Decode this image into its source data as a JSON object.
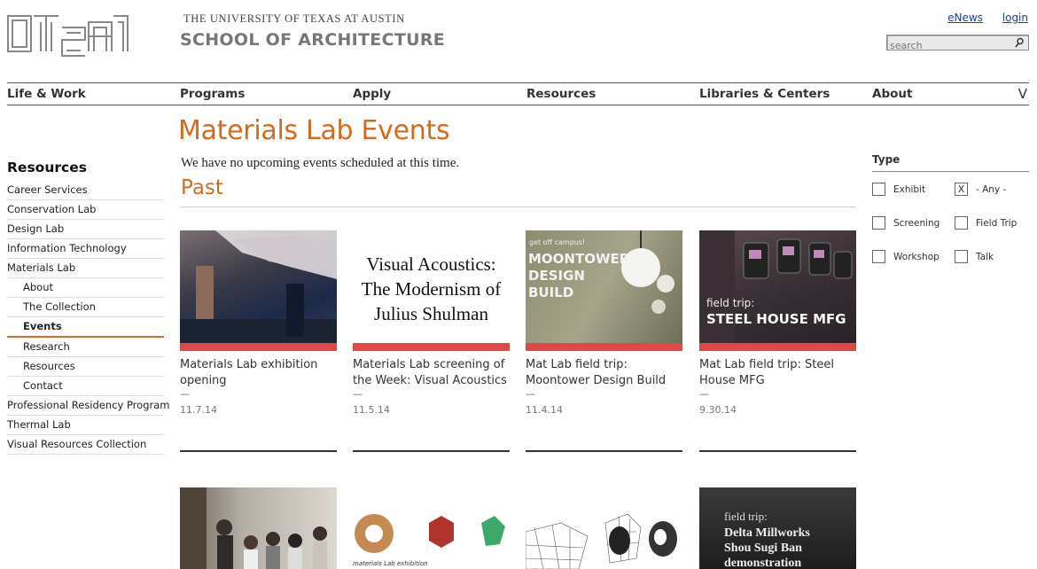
{
  "header": {
    "university": "THE UNIVERSITY OF TEXAS AT AUSTIN",
    "school": "SCHOOL OF ARCHITECTURE",
    "links": [
      "eNews",
      "login"
    ],
    "search_placeholder": "search"
  },
  "nav": {
    "items": [
      "Life & Work",
      "Programs",
      "Apply",
      "Resources",
      "Libraries & Centers",
      "About"
    ],
    "toggle": "V"
  },
  "page": {
    "title": "Materials Lab Events",
    "no_events": "We have no upcoming events scheduled at this time.",
    "past_heading": "Past"
  },
  "sidebar": {
    "heading": "Resources",
    "items": [
      {
        "label": "Career Services",
        "level": 0
      },
      {
        "label": "Conservation Lab",
        "level": 0
      },
      {
        "label": "Design Lab",
        "level": 0
      },
      {
        "label": "Information Technology",
        "level": 0
      },
      {
        "label": "Materials Lab",
        "level": 0
      },
      {
        "label": "About",
        "level": 1
      },
      {
        "label": "The Collection",
        "level": 1
      },
      {
        "label": "Events",
        "level": 1,
        "active": true
      },
      {
        "label": "Research",
        "level": 1
      },
      {
        "label": "Resources",
        "level": 1
      },
      {
        "label": "Contact",
        "level": 1
      },
      {
        "label": "Professional Residency Program",
        "level": 0
      },
      {
        "label": "Thermal Lab",
        "level": 0
      },
      {
        "label": "Visual Resources Collection",
        "level": 0
      }
    ]
  },
  "filters": {
    "heading": "Type",
    "options": [
      {
        "label": "Exhibit",
        "checked": false
      },
      {
        "label": "- Any -",
        "checked": true
      },
      {
        "label": "Screening",
        "checked": false
      },
      {
        "label": "Field Trip",
        "checked": false
      },
      {
        "label": "Workshop",
        "checked": false
      },
      {
        "label": "Talk",
        "checked": false
      }
    ],
    "check_mark": "X"
  },
  "events": [
    {
      "title": "Materials Lab exhibition opening",
      "dash": "—",
      "date": "11.7.14"
    },
    {
      "title": "Materials Lab screening of the Week: Visual Acoustics",
      "dash": "—",
      "date": "11.5.14",
      "thumb_lines": [
        "Visual Acoustics:",
        "The Modernism of",
        "Julius Shulman"
      ]
    },
    {
      "title": "Mat Lab field trip: Moontower Design Build",
      "dash": "—",
      "date": "11.4.14",
      "thumb_small": "get off campus!",
      "thumb_lines": [
        "MOONTOWER",
        "DESIGN",
        "BUILD"
      ]
    },
    {
      "title": "Mat Lab field trip: Steel House MFG",
      "dash": "—",
      "date": "9.30.14",
      "thumb_small": "field trip:",
      "thumb_lines": [
        "STEEL HOUSE MFG"
      ]
    }
  ],
  "events_row2": [
    {
      "thumb_lines": []
    },
    {
      "thumb_small": "materials Lab exhibition"
    },
    {
      "thumb_lines": []
    },
    {
      "thumb_small": "field trip:",
      "thumb_lines": [
        "Delta Millworks",
        "Shou Sugi Ban",
        "demonstration"
      ]
    }
  ]
}
